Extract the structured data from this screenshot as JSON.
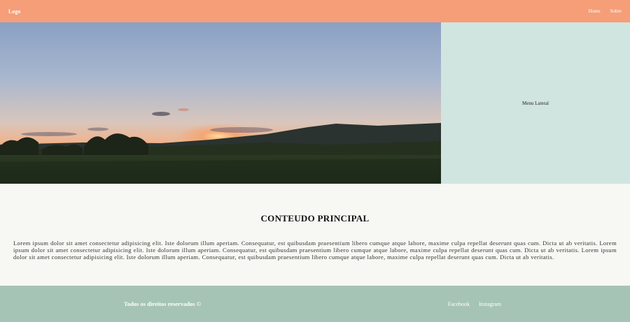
{
  "header": {
    "logo": "Logo",
    "nav": [
      "Home",
      "Sobre"
    ]
  },
  "hero": {
    "side_menu_label": "Menu Lateral"
  },
  "main": {
    "title": "CONTEUDO PRINCIPAL",
    "paragraph": "Lorem ipsum dolor sit amet consectetur adipisicing elit. Iste dolorum illum aperiam. Consequatur, est quibusdam praesentium libero cumque atque labore, maxime culpa repellat deserunt quas cum. Dicta ut ab veritatis. Lorem ipsum dolor sit amet consectetur adipisicing elit. Iste dolorum illum aperiam. Consequatur, est quibusdam praesentium libero cumque atque labore, maxime culpa repellat deserunt quas cum. Dicta ut ab veritatis. Lorem ipsum dolor sit amet consectetur adipisicing elit. Iste dolorum illum aperiam. Consequatur, est quibusdam praesentium libero cumque atque labore, maxime culpa repellat deserunt quas cum. Dicta ut ab veritatis."
  },
  "footer": {
    "copyright": "Todos os direitos reservados ©",
    "social": [
      "Facebook",
      "Instagram"
    ]
  },
  "colors": {
    "header": "#f59e78",
    "side_menu": "#d1e5e0",
    "footer": "#a6c4b5",
    "main_bg": "#f7f7f3"
  }
}
